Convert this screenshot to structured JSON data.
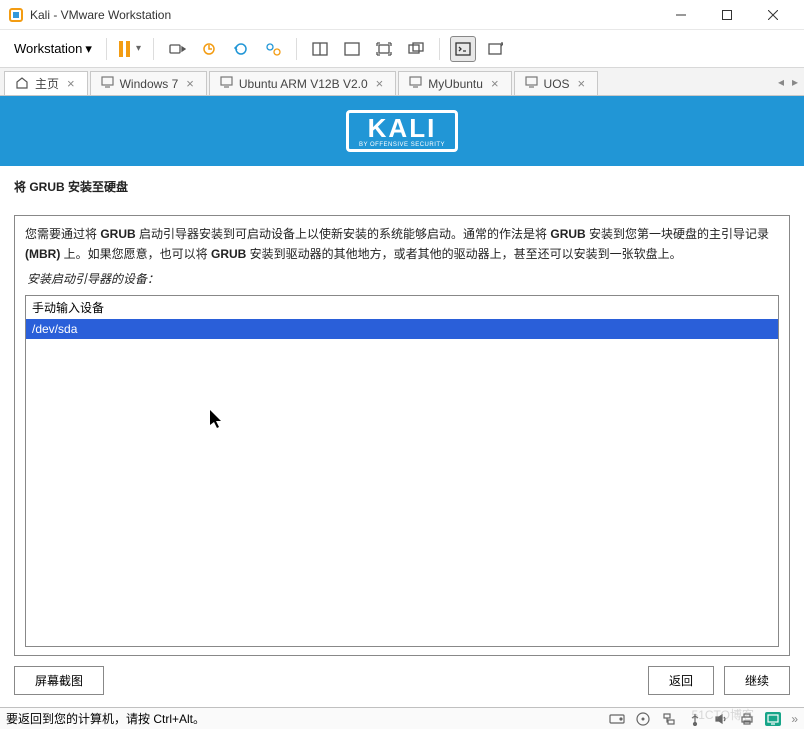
{
  "window": {
    "title": "Kali - VMware Workstation"
  },
  "menu": {
    "workstation": "Workstation"
  },
  "tabs": [
    {
      "label": "主页",
      "type": "home"
    },
    {
      "label": "Windows 7",
      "type": "vm"
    },
    {
      "label": "Ubuntu ARM V12B V2.0",
      "type": "vm"
    },
    {
      "label": "MyUbuntu",
      "type": "vm"
    },
    {
      "label": "UOS",
      "type": "vm"
    }
  ],
  "kali": {
    "logo": "KALI",
    "sub": "BY OFFENSIVE SECURITY"
  },
  "installer": {
    "title": "将 GRUB 安装至硬盘",
    "desc_prefix": "您需要通过将 ",
    "desc_b1": "GRUB",
    "desc_mid1": " 启动引导器安装到可启动设备上以使新安装的系统能够启动。通常的作法是将 ",
    "desc_b2": "GRUB",
    "desc_mid2": " 安装到您第一块硬盘的主引导记录 ",
    "desc_b3": "(MBR)",
    "desc_mid3": " 上。如果您愿意，也可以将 ",
    "desc_b4": "GRUB",
    "desc_end": " 安装到驱动器的其他地方，或者其他的驱动器上，甚至还可以安装到一张软盘上。",
    "label": "安装启动引导器的设备：",
    "items": [
      {
        "label": "手动输入设备",
        "selected": false
      },
      {
        "label": "/dev/sda",
        "selected": true
      }
    ],
    "screenshot_btn": "屏幕截图",
    "back_btn": "返回",
    "continue_btn": "继续"
  },
  "statusbar": {
    "text": "要返回到您的计算机，请按 Ctrl+Alt。"
  },
  "watermark": "51CTO博客"
}
